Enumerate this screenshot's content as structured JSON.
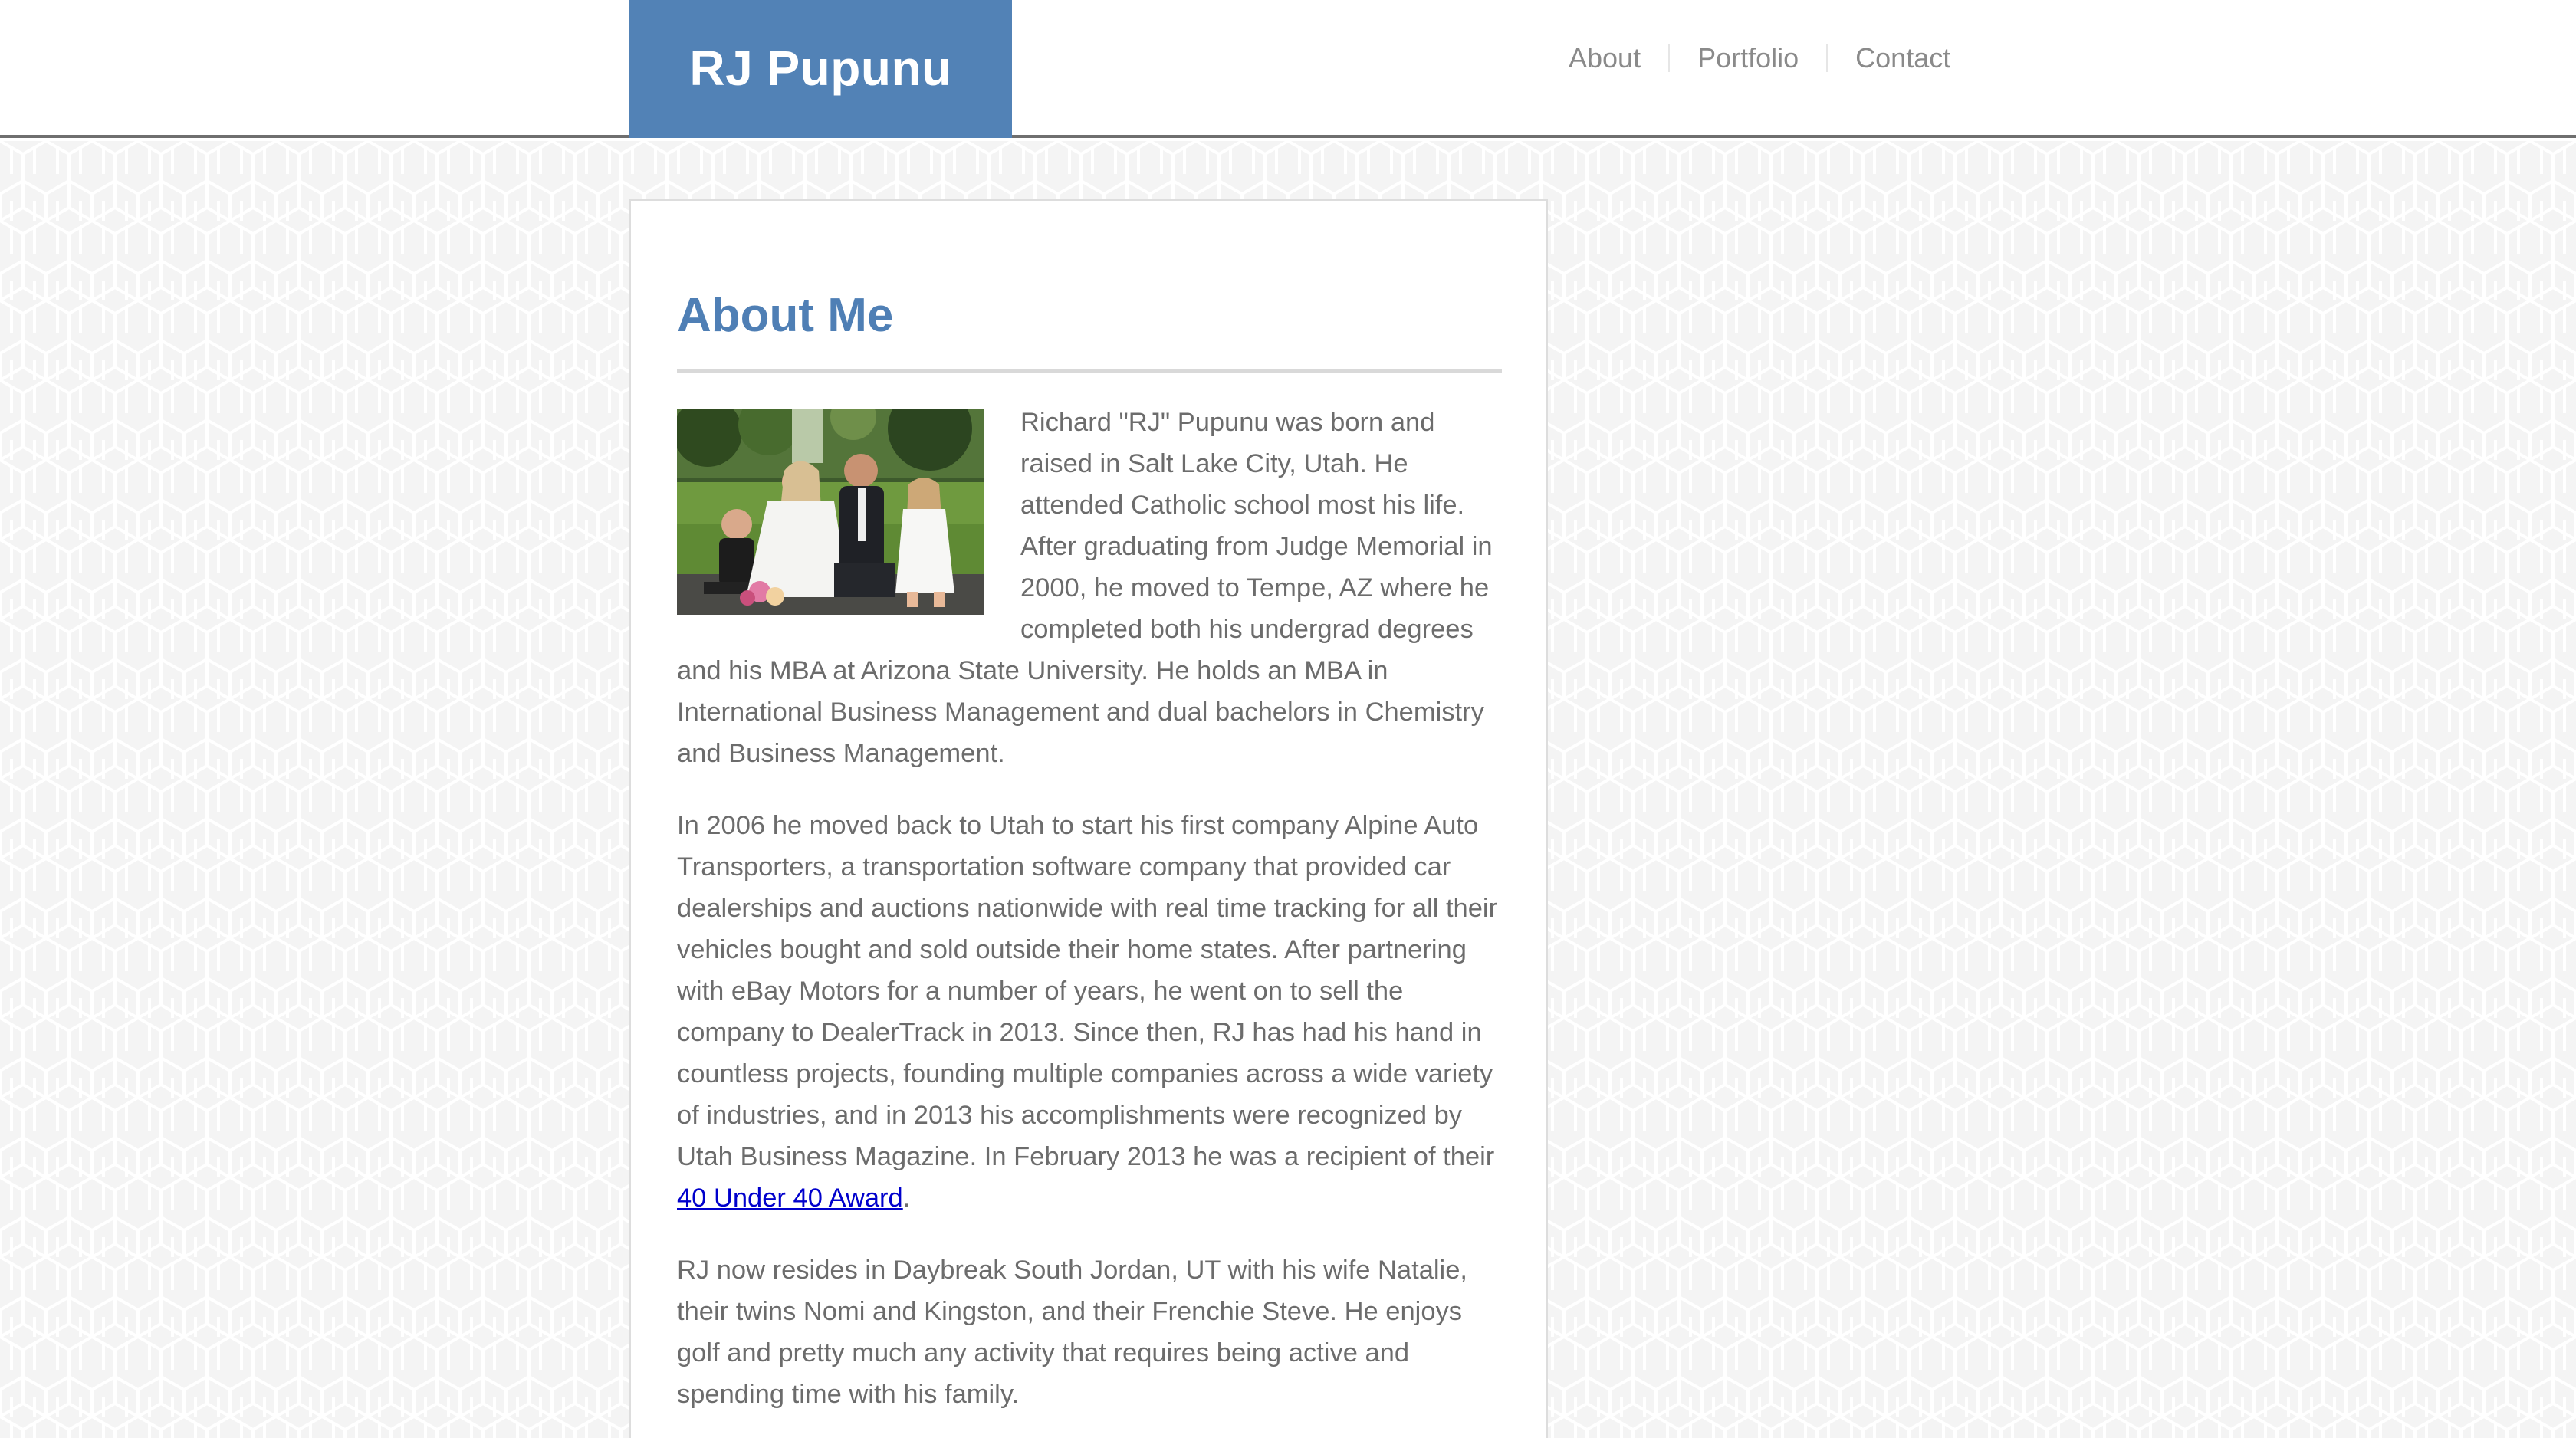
{
  "header": {
    "brand_name": "RJ Pupunu",
    "brand_color": "#5282b6",
    "nav": [
      {
        "label": "About"
      },
      {
        "label": "Portfolio"
      },
      {
        "label": "Contact"
      }
    ]
  },
  "main": {
    "title": "About Me",
    "title_color": "#4f7fb5",
    "photo_icon": "family-photo",
    "paragraphs": {
      "p1": "Richard \"RJ\" Pupunu was born and raised in Salt Lake City, Utah. He attended Catholic school most his life. After graduating from Judge Memorial in 2000, he moved to Tempe, AZ where he completed both his undergrad degrees and his MBA at Arizona State University. He holds an MBA in International Business Management and dual bachelors in Chemistry and Business Management.",
      "p2_before_link": "In 2006 he moved back to Utah to start his first company Alpine Auto Transporters, a transportation software company that provided car dealerships and auctions nationwide with real time tracking for all their vehicles bought and sold outside their home states. After partnering with eBay Motors for a number of years, he went on to sell the company to DealerTrack in 2013. Since then, RJ has had his hand in countless projects, founding multiple companies across a wide variety of industries, and in 2013 his accomplishments were recognized by Utah Business Magazine. In February 2013 he was a recipient of their ",
      "p2_link_text": "40 Under 40 Award",
      "p2_after_link": ".",
      "p3": "RJ now resides in Daybreak South Jordan, UT with his wife Natalie, their twins Nomi and Kingston, and their Frenchie Steve. He enjoys golf and pretty much any activity that requires being active and spending time with his family."
    },
    "link_color": "#0000cc"
  }
}
